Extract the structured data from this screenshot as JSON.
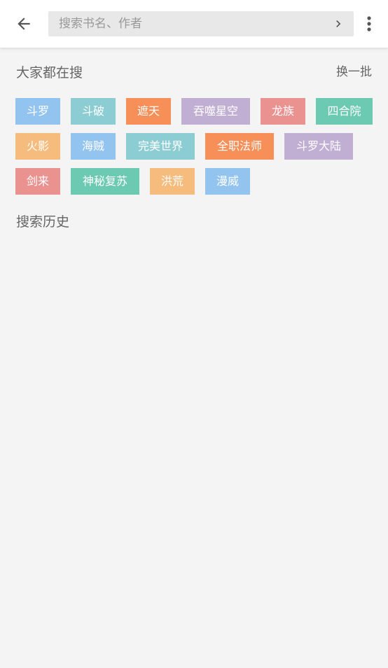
{
  "header": {
    "search_placeholder": "搜索书名、作者"
  },
  "hot": {
    "title": "大家都在搜",
    "refresh_label": "换一批",
    "tags": [
      {
        "label": "斗罗",
        "color": "#93c4ef"
      },
      {
        "label": "斗破",
        "color": "#8ccdd3"
      },
      {
        "label": "遮天",
        "color": "#f79058"
      },
      {
        "label": "吞噬星空",
        "color": "#c1aed3"
      },
      {
        "label": "龙族",
        "color": "#ea9290"
      },
      {
        "label": "四合院",
        "color": "#6dcab2"
      },
      {
        "label": "火影",
        "color": "#f6bc7e"
      },
      {
        "label": "海贼",
        "color": "#93c4ef"
      },
      {
        "label": "完美世界",
        "color": "#8ccdd3"
      },
      {
        "label": "全职法师",
        "color": "#f79058"
      },
      {
        "label": "斗罗大陆",
        "color": "#c1aed3"
      },
      {
        "label": "剑来",
        "color": "#ea9290"
      },
      {
        "label": "神秘复苏",
        "color": "#6dcab2"
      },
      {
        "label": "洪荒",
        "color": "#f6bc7e"
      },
      {
        "label": "漫威",
        "color": "#93c4ef"
      }
    ]
  },
  "history": {
    "title": "搜索历史",
    "items": []
  }
}
